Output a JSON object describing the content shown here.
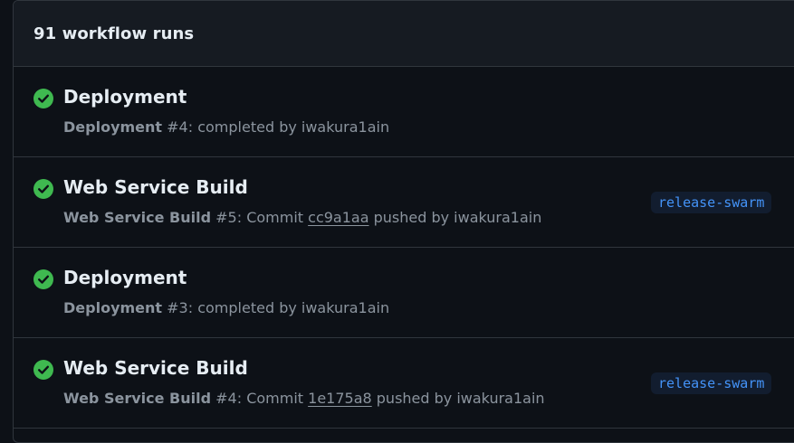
{
  "header": {
    "title": "91 workflow runs"
  },
  "runs": [
    {
      "title": "Deployment",
      "workflow": "Deployment",
      "number_text": " #4: completed by iwakura1ain",
      "status": "success",
      "status_icon": "check-circle-icon"
    },
    {
      "title": "Web Service Build",
      "workflow": "Web Service Build",
      "number_text": " #5: Commit ",
      "commit": "cc9a1aa",
      "tail_text": " pushed by iwakura1ain",
      "branch": "release-swarm",
      "status": "success",
      "status_icon": "check-circle-icon"
    },
    {
      "title": "Deployment",
      "workflow": "Deployment",
      "number_text": " #3: completed by iwakura1ain",
      "status": "success",
      "status_icon": "check-circle-icon"
    },
    {
      "title": "Web Service Build",
      "workflow": "Web Service Build",
      "number_text": " #4: Commit ",
      "commit": "1e175a8",
      "tail_text": " pushed by iwakura1ain",
      "branch": "release-swarm",
      "status": "success",
      "status_icon": "check-circle-icon"
    }
  ],
  "colors": {
    "background": "#0d1117",
    "header_background": "#161b22",
    "border": "#30363d",
    "success": "#3fb950",
    "branch_text": "#4493f8",
    "branch_background": "#121d2f",
    "muted_text": "#8b949e"
  }
}
